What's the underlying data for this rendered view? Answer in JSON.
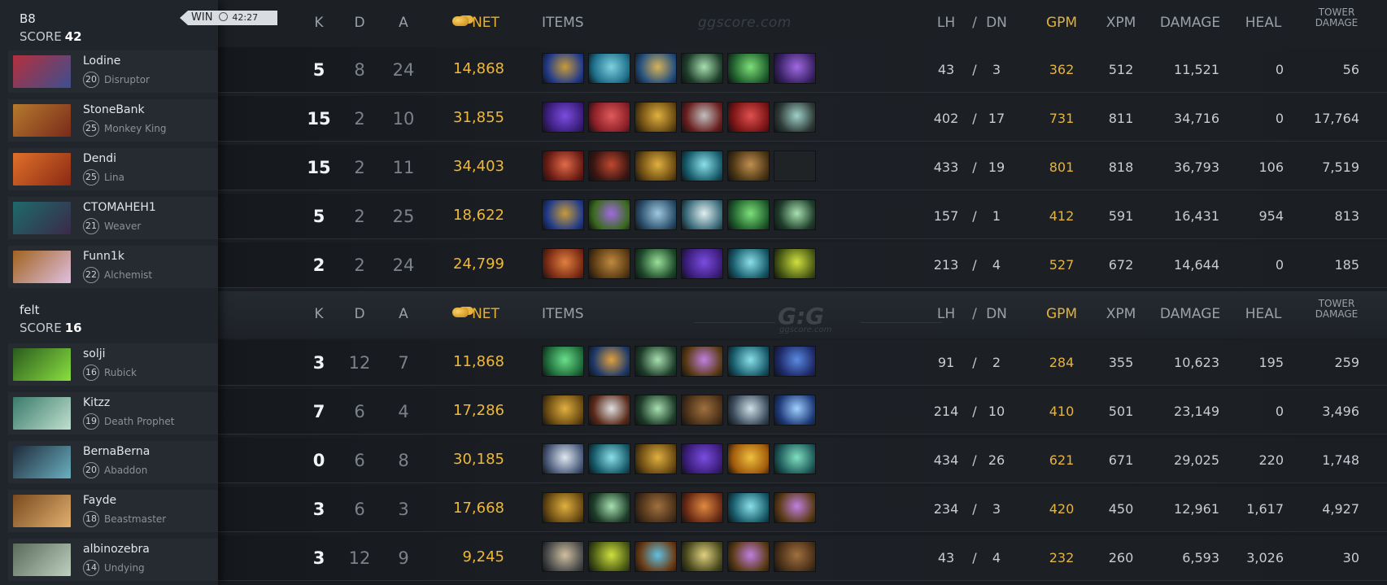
{
  "teams": [
    {
      "name": "B8",
      "score_label": "SCORE",
      "score": "42",
      "result": "WIN",
      "duration": "42:27",
      "players": [
        {
          "name": "Lodine",
          "level": "20",
          "hero": "Disruptor",
          "k": "5",
          "d": "8",
          "a": "24",
          "net": "14,868",
          "lh": "43",
          "dn": "3",
          "gpm": "362",
          "xpm": "512",
          "damage": "11,521",
          "heal": "0",
          "tower": "56",
          "portrait": [
            "#b52f3d",
            "#3c4f8f"
          ],
          "items": [
            [
              "#223b8a",
              "#c79b3a"
            ],
            [
              "#1e6f8a",
              "#7fd0e0"
            ],
            [
              "#244f7d",
              "#d8b25a"
            ],
            [
              "#1e3d2a",
              "#a8e0b0"
            ],
            [
              "#1f5e2c",
              "#7ee07a"
            ],
            [
              "#3a2266",
              "#a069e0"
            ]
          ]
        },
        {
          "name": "StoneBank",
          "level": "25",
          "hero": "Monkey King",
          "k": "15",
          "d": "2",
          "a": "10",
          "net": "31,855",
          "lh": "402",
          "dn": "17",
          "gpm": "731",
          "xpm": "811",
          "damage": "34,716",
          "heal": "0",
          "tower": "17,764",
          "portrait": [
            "#b57a2e",
            "#7a2a1a"
          ],
          "items": [
            [
              "#3b1d7a",
              "#7a4de0"
            ],
            [
              "#8a1f27",
              "#e05a5a"
            ],
            [
              "#6a4a12",
              "#e0b040"
            ],
            [
              "#6a1e1e",
              "#c0c0c0"
            ],
            [
              "#7a1414",
              "#e05050"
            ],
            [
              "#2e3a38",
              "#9fd0c8"
            ]
          ]
        },
        {
          "name": "Dendi",
          "level": "25",
          "hero": "Lina",
          "k": "15",
          "d": "2",
          "a": "11",
          "net": "34,403",
          "lh": "433",
          "dn": "19",
          "gpm": "801",
          "xpm": "818",
          "damage": "36,793",
          "heal": "106",
          "tower": "7,519",
          "portrait": [
            "#e0702a",
            "#8a2a14"
          ],
          "items": [
            [
              "#6a1c14",
              "#e06a4a"
            ],
            [
              "#3a1612",
              "#c04830"
            ],
            [
              "#6a4a12",
              "#e0b040"
            ],
            [
              "#175a6a",
              "#8ae0e8"
            ],
            [
              "#4a3414",
              "#c09050"
            ],
            [
              "#202326",
              "#202326"
            ]
          ]
        },
        {
          "name": "СТОМАНЕН1",
          "level": "21",
          "hero": "Weaver",
          "k": "5",
          "d": "2",
          "a": "25",
          "net": "18,622",
          "lh": "157",
          "dn": "1",
          "gpm": "412",
          "xpm": "591",
          "damage": "16,431",
          "heal": "954",
          "tower": "813",
          "portrait": [
            "#1f6a6a",
            "#3a2a4a"
          ],
          "items": [
            [
              "#223b8a",
              "#c79b3a"
            ],
            [
              "#3a6a1e",
              "#a06ae0"
            ],
            [
              "#2a4e6a",
              "#a0c8e0"
            ],
            [
              "#3a6a7a",
              "#e0f0f0"
            ],
            [
              "#1f5e2c",
              "#7ee07a"
            ],
            [
              "#1e3d2a",
              "#a8e0b0"
            ]
          ]
        },
        {
          "name": "Funn1k",
          "level": "22",
          "hero": "Alchemist",
          "k": "2",
          "d": "2",
          "a": "24",
          "net": "24,799",
          "lh": "213",
          "dn": "4",
          "gpm": "527",
          "xpm": "672",
          "damage": "14,644",
          "heal": "0",
          "tower": "185",
          "portrait": [
            "#a0621e",
            "#e0c0e0"
          ],
          "items": [
            [
              "#7a2a14",
              "#e08040"
            ],
            [
              "#5a3a14",
              "#c08a40"
            ],
            [
              "#1e4a2a",
              "#9ae09a"
            ],
            [
              "#3b1d7a",
              "#7a4de0"
            ],
            [
              "#175a6a",
              "#8ae0e8"
            ],
            [
              "#4a5a14",
              "#d0e040"
            ]
          ]
        }
      ]
    },
    {
      "name": "felt",
      "score_label": "SCORE",
      "score": "16",
      "players": [
        {
          "name": "solji",
          "level": "16",
          "hero": "Rubick",
          "k": "3",
          "d": "12",
          "a": "7",
          "net": "11,868",
          "lh": "91",
          "dn": "2",
          "gpm": "284",
          "xpm": "355",
          "damage": "10,623",
          "heal": "195",
          "tower": "259",
          "portrait": [
            "#2a5a1e",
            "#8ae040"
          ],
          "items": [
            [
              "#1e6a3a",
              "#6ae08a"
            ],
            [
              "#1e3a6a",
              "#e0a040"
            ],
            [
              "#1e3d2a",
              "#a8e0b0"
            ],
            [
              "#5a3a14",
              "#c080e0"
            ],
            [
              "#175a6a",
              "#8ae0e8"
            ],
            [
              "#1e2a6a",
              "#5a8ae0"
            ]
          ]
        },
        {
          "name": "Kitzz",
          "level": "19",
          "hero": "Death Prophet",
          "k": "7",
          "d": "6",
          "a": "4",
          "net": "17,286",
          "lh": "214",
          "dn": "10",
          "gpm": "410",
          "xpm": "501",
          "damage": "23,149",
          "heal": "0",
          "tower": "3,496",
          "portrait": [
            "#3a7a6a",
            "#c0e0d0"
          ],
          "items": [
            [
              "#6a4a12",
              "#e0b040"
            ],
            [
              "#5a2a1a",
              "#e0e0e0"
            ],
            [
              "#1e3d2a",
              "#a8e0b0"
            ],
            [
              "#4a3018",
              "#a07040"
            ],
            [
              "#3a4a5a",
              "#d0e0e8"
            ],
            [
              "#1e3a7a",
              "#a0d0ff"
            ]
          ]
        },
        {
          "name": "BernaBerna",
          "level": "20",
          "hero": "Abaddon",
          "k": "0",
          "d": "6",
          "a": "8",
          "net": "30,185",
          "lh": "434",
          "dn": "26",
          "gpm": "621",
          "xpm": "671",
          "damage": "29,025",
          "heal": "220",
          "tower": "1,748",
          "portrait": [
            "#1e2a3a",
            "#6ab0c0"
          ],
          "items": [
            [
              "#4a5a7a",
              "#e0e8f0"
            ],
            [
              "#175a6a",
              "#8ae0e8"
            ],
            [
              "#6a4a12",
              "#e0b040"
            ],
            [
              "#3b1d7a",
              "#7a4de0"
            ],
            [
              "#a05a0a",
              "#f0c040"
            ],
            [
              "#1e5a5a",
              "#80e0c0"
            ]
          ]
        },
        {
          "name": "Fayde",
          "level": "18",
          "hero": "Beastmaster",
          "k": "3",
          "d": "6",
          "a": "3",
          "net": "17,668",
          "lh": "234",
          "dn": "3",
          "gpm": "420",
          "xpm": "450",
          "damage": "12,961",
          "heal": "1,617",
          "tower": "4,927",
          "portrait": [
            "#7a4a1e",
            "#e0b070"
          ],
          "items": [
            [
              "#6a4a12",
              "#e0b040"
            ],
            [
              "#1e3d2a",
              "#a8e0b0"
            ],
            [
              "#4a3018",
              "#a07040"
            ],
            [
              "#6a2a14",
              "#e08a40"
            ],
            [
              "#175a6a",
              "#8ae0e8"
            ],
            [
              "#5a3a14",
              "#c080e0"
            ]
          ]
        },
        {
          "name": "albinozebra",
          "level": "14",
          "hero": "Undying",
          "k": "3",
          "d": "12",
          "a": "9",
          "net": "9,245",
          "lh": "43",
          "dn": "4",
          "gpm": "232",
          "xpm": "260",
          "damage": "6,593",
          "heal": "3,026",
          "tower": "30",
          "portrait": [
            "#5a6a5a",
            "#c0d0c0"
          ],
          "items": [
            [
              "#4a4a4a",
              "#d0c0a0"
            ],
            [
              "#4a5a14",
              "#d0e040"
            ],
            [
              "#6a3a14",
              "#60c0e0"
            ],
            [
              "#4a4a1e",
              "#e0d080"
            ],
            [
              "#5a3a14",
              "#c080e0"
            ],
            [
              "#4a3018",
              "#a07040"
            ]
          ]
        }
      ]
    }
  ],
  "columns": {
    "k": "K",
    "d": "D",
    "a": "A",
    "net": "NET",
    "items": "ITEMS",
    "lh": "LH",
    "sep": "/",
    "dn": "DN",
    "gpm": "GPM",
    "xpm": "XPM",
    "damage": "DAMAGE",
    "heal": "HEAL",
    "tower_line1": "TOWER",
    "tower_line2": "DAMAGE"
  },
  "watermark": {
    "site": "ggscore.com",
    "logo": "G:G",
    "logo_sub": "ggscore.com"
  },
  "icons": {
    "net": "gold-coins-icon",
    "clock": "clock-icon"
  },
  "colors": {
    "gold": "#e3b13a",
    "net": "#f0b838",
    "panel": "#20252b",
    "background": "#181c21"
  }
}
